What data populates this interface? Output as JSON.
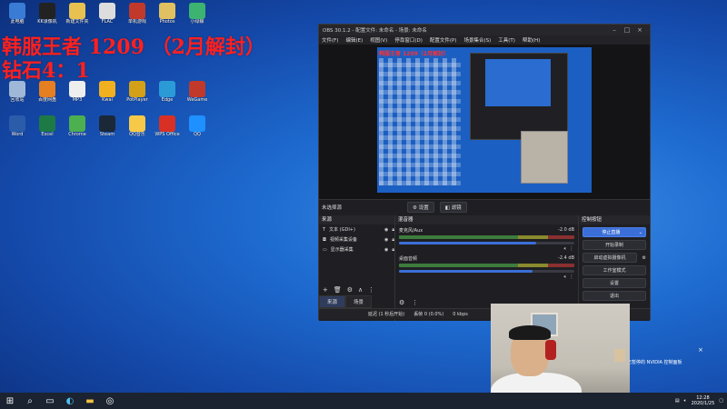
{
  "overlay": {
    "line1": "韩服王者 1209 （2月解封）",
    "line2": "钻石4：1"
  },
  "desktop_icons": [
    {
      "label": "此电脑",
      "color": "#3a7bd5"
    },
    {
      "label": "KK录像机",
      "color": "#222222"
    },
    {
      "label": "新建文件夹",
      "color": "#e8c150"
    },
    {
      "label": "FLAC",
      "color": "#dddddd"
    },
    {
      "label": "单机游戏",
      "color": "#c0392b"
    },
    {
      "label": "Photos",
      "color": "#e0c060"
    },
    {
      "label": "小绿鲸",
      "color": "#3cb371"
    },
    {
      "label": "回收站",
      "color": "#9fb8d8"
    },
    {
      "label": "百度网盘",
      "color": "#e67e22"
    },
    {
      "label": "MP3",
      "color": "#eeeeee"
    },
    {
      "label": "Kwai",
      "color": "#f0b020"
    },
    {
      "label": "PotPlayer",
      "color": "#d4a017"
    },
    {
      "label": "Edge",
      "color": "#2b9bd8"
    },
    {
      "label": "WeGame",
      "color": "#c0392b"
    },
    {
      "label": "Word",
      "color": "#2a5caa"
    },
    {
      "label": "Excel",
      "color": "#1d7a45"
    },
    {
      "label": "Chrome",
      "color": "#4caf50"
    },
    {
      "label": "Steam",
      "color": "#1b2838"
    },
    {
      "label": "QQ音乐",
      "color": "#f7c948"
    },
    {
      "label": "WPS Office",
      "color": "#d93025"
    },
    {
      "label": "QQ",
      "color": "#1e90ff"
    }
  ],
  "obs": {
    "title": "OBS 30.1.2 - 配置文件: 未命名 - 场景: 未命名",
    "menu": [
      "文件(F)",
      "编辑(E)",
      "视图(V)",
      "停靠窗口(D)",
      "配置文件(P)",
      "场景集合(S)",
      "工具(T)",
      "帮助(H)"
    ],
    "preview_text": "韩服王者 1209（2月解封）",
    "toolbar": {
      "no_source": "未选择源",
      "settings": "设置",
      "filters": "滤镜"
    },
    "sources": {
      "title": "来源",
      "items": [
        {
          "icon": "text-icon",
          "name": "文本 (GDI+)"
        },
        {
          "icon": "camera-icon",
          "name": "视频采集设备"
        },
        {
          "icon": "monitor-icon",
          "name": "显示器采集"
        }
      ]
    },
    "mixer": {
      "title": "混音器",
      "channels": [
        {
          "name": "麦克风/Aux",
          "db": "-2.0 dB",
          "level": 0.78
        },
        {
          "name": "桌面音频",
          "db": "-2.4 dB",
          "level": 0.76
        }
      ]
    },
    "controls": {
      "title": "控制按钮",
      "stop_stream": "停止直播",
      "start_record": "开始录制",
      "virtual_cam": "启动虚拟摄像机",
      "studio_mode": "工作室模式",
      "settings": "设置",
      "exit": "退出"
    },
    "tabs": {
      "sources": "来源",
      "scenes": "场景"
    },
    "status": {
      "delay": "延迟 (1 秒后开始)",
      "dropped": "丢帧 0 (0.0%)",
      "bitrate": "0 kbps"
    }
  },
  "notification": "已暂停的 NVIDIA 控制面板",
  "taskbar": {
    "time": "12:28",
    "date": "2020/1/25"
  }
}
